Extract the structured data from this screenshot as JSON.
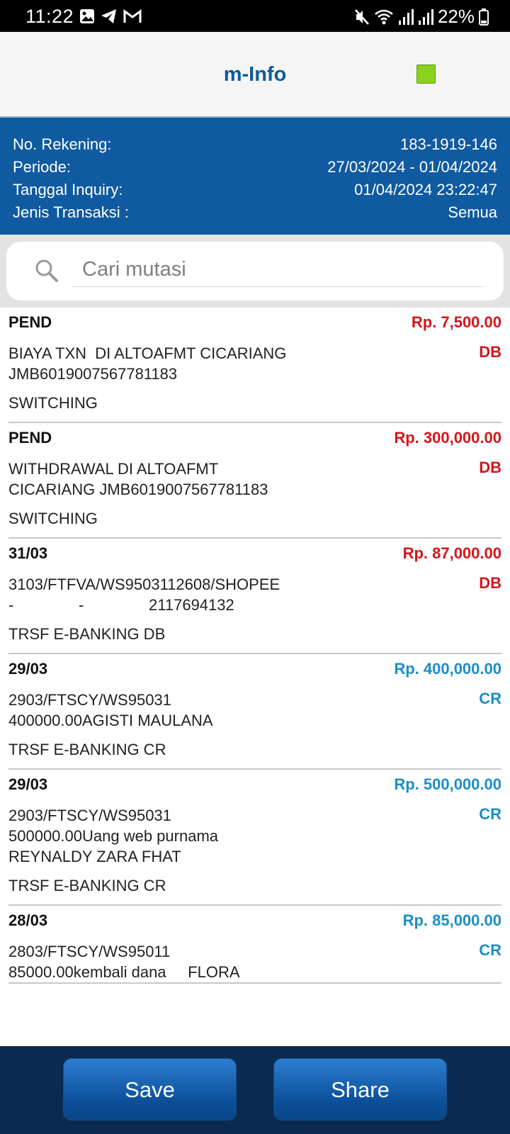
{
  "status_bar": {
    "time": "11:22",
    "battery": "22%",
    "left_icons": [
      "gallery-icon",
      "telegram-icon",
      "gmail-icon"
    ],
    "right_icons": [
      "mute-icon",
      "wifi-icon",
      "signal-icon",
      "signal-icon",
      "battery-icon"
    ]
  },
  "app": {
    "title": "m-Info",
    "status_indicator_color": "#8bd11f"
  },
  "account": {
    "rows": [
      {
        "label": "No. Rekening:",
        "value": "183-1919-146"
      },
      {
        "label": "Periode:",
        "value": "27/03/2024 - 01/04/2024"
      },
      {
        "label": "Tanggal Inquiry:",
        "value": "01/04/2024 23:22:47"
      },
      {
        "label": "Jenis Transaksi :",
        "value": "Semua"
      }
    ]
  },
  "search": {
    "placeholder": "Cari mutasi",
    "value": ""
  },
  "transactions": [
    {
      "date": "PEND",
      "amount": "Rp. 7,500.00",
      "type": "DB",
      "description": "BIAYA TXN  DI ALTOAFMT CICARIANG\nJMB6019007567781183",
      "category": "SWITCHING"
    },
    {
      "date": "PEND",
      "amount": "Rp. 300,000.00",
      "type": "DB",
      "description": "WITHDRAWAL DI ALTOAFMT\nCICARIANG JMB6019007567781183",
      "category": "SWITCHING"
    },
    {
      "date": "31/03",
      "amount": "Rp. 87,000.00",
      "type": "DB",
      "description": "3103/FTFVA/WS9503112608/SHOPEE\n-               -               2117694132",
      "category": "TRSF E-BANKING DB"
    },
    {
      "date": "29/03",
      "amount": "Rp. 400,000.00",
      "type": "CR",
      "description": "2903/FTSCY/WS95031\n400000.00AGISTI MAULANA",
      "category": "TRSF E-BANKING CR"
    },
    {
      "date": "29/03",
      "amount": "Rp. 500,000.00",
      "type": "CR",
      "description": "2903/FTSCY/WS95031\n500000.00Uang web purnama\nREYNALDY ZARA FHAT",
      "category": "TRSF E-BANKING CR"
    },
    {
      "date": "28/03",
      "amount": "Rp. 85,000.00",
      "type": "CR",
      "description": "2803/FTSCY/WS95011\n85000.00kembali dana     FLORA",
      "category": ""
    }
  ],
  "buttons": {
    "save": "Save",
    "share": "Share"
  },
  "colors": {
    "primary": "#0f5aa0",
    "debit": "#d7141a",
    "credit": "#1b8ec6",
    "bottom_bar": "#0a2b4f"
  }
}
